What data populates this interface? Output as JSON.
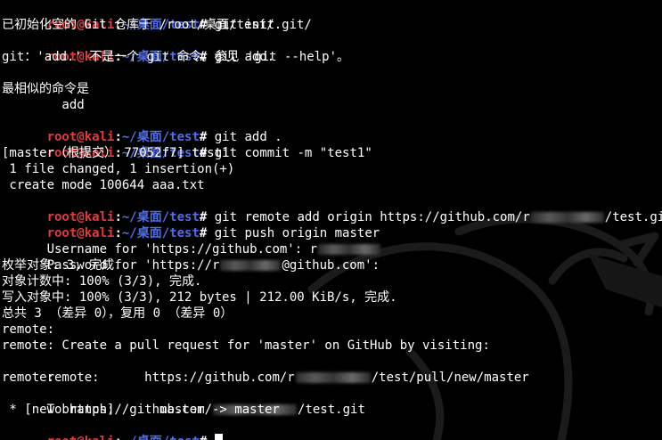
{
  "prompt": {
    "user": "root@kali",
    "sep": ":",
    "path": "~/桌面/test",
    "symbol": "#"
  },
  "lines": {
    "l0": {
      "cmd": " git init"
    },
    "l1": {
      "text": "已初始化空的 Git 仓库于 /root/桌面/test/.git/"
    },
    "l2": {
      "cmd": " git add."
    },
    "l3": {
      "text": "git：'add.' 不是一个 git 命令。参见 'git --help'。"
    },
    "l5": {
      "text": "最相似的命令是"
    },
    "l6": {
      "text": "        add"
    },
    "l7": {
      "cmd": " git add ."
    },
    "l8": {
      "cmd": " git commit -m \"test1\""
    },
    "l9": {
      "text": "[master（根提交） 77052f7] test1"
    },
    "l10": {
      "text": " 1 file changed, 1 insertion(+)"
    },
    "l11": {
      "text": " create mode 100644 aaa.txt"
    },
    "l12": {
      "cmd_a": " git remote add origin https://github.com/r",
      "cmd_b": "/test.git"
    },
    "l13": {
      "cmd": " git push origin master"
    },
    "l14": {
      "a": "Username for 'https://github.com': r"
    },
    "l15": {
      "a": "Password for 'https://r",
      "b": "@github.com':"
    },
    "l16": {
      "text": "枚举对象: 3, 完成."
    },
    "l17": {
      "text": "对象计数中: 100% (3/3), 完成."
    },
    "l18": {
      "text": "写入对象中: 100% (3/3), 212 bytes | 212.00 KiB/s, 完成."
    },
    "l19": {
      "text": "总共 3 （差异 0），复用 0 （差异 0）"
    },
    "l20": {
      "text": "remote:"
    },
    "l21": {
      "text": "remote: Create a pull request for 'master' on GitHub by visiting:"
    },
    "l22": {
      "a": "remote:      https://github.com/r",
      "b": "/test/pull/new/master"
    },
    "l23": {
      "text": "remote:"
    },
    "l24": {
      "a": "To https://github.com/",
      "b": "/test.git"
    },
    "l25": {
      "text": " * [new branch]      master -> master"
    }
  },
  "colors": {
    "background": "#000000",
    "prompt_user": "#e23b3b",
    "prompt_path": "#4f6ee6",
    "text": "#ffffff",
    "watermark": "#1a1a1a"
  },
  "icons": {
    "watermark": "kali-dragon-watermark-icon"
  }
}
